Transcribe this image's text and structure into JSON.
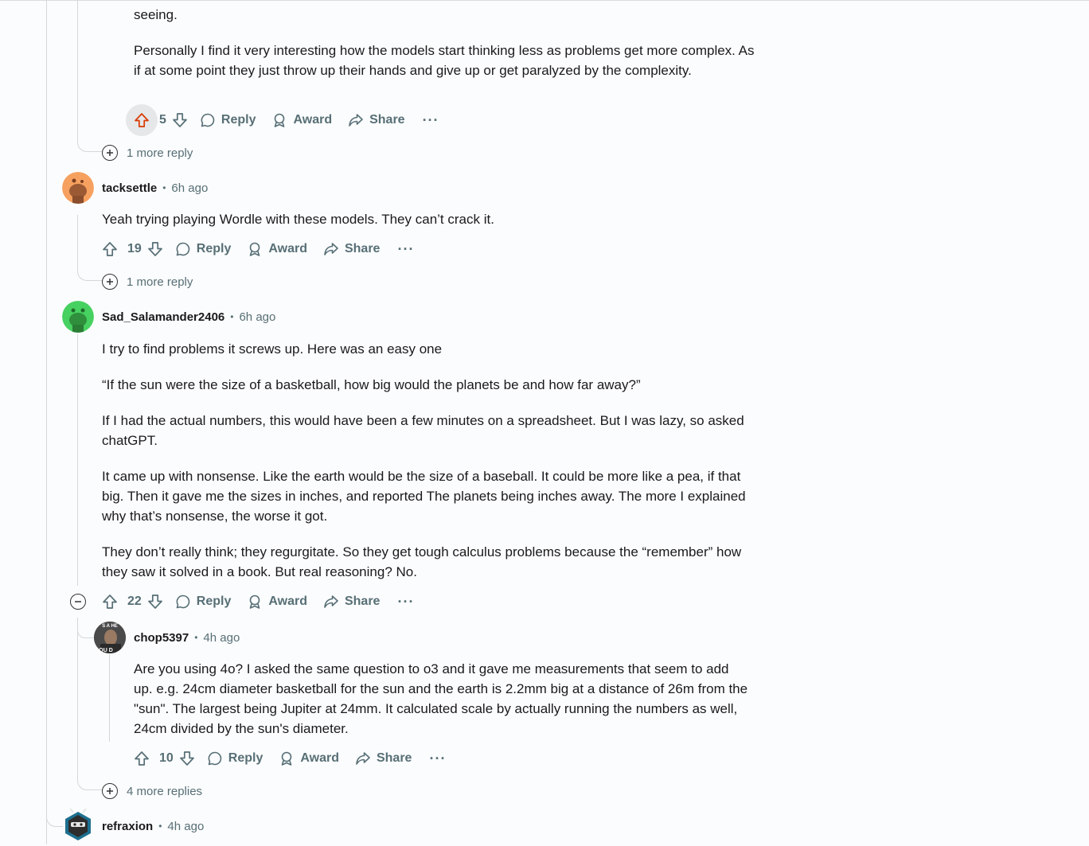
{
  "comment1": {
    "partial_text": "seeing.",
    "paragraph": "Personally I find it very interesting how the models start thinking less as problems get more complex. As if at some point they just throw up their hands and give up or get paralyzed by the complexity.",
    "score": "5",
    "more_replies": "1 more reply"
  },
  "comment2": {
    "author": "tacksettle",
    "time": "6h ago",
    "paragraph": "Yeah trying playing Wordle with these models. They can’t crack it.",
    "score": "19",
    "more_replies": "1 more reply"
  },
  "comment3": {
    "author": "Sad_Salamander2406",
    "time": "6h ago",
    "paragraphs": [
      "I try to find problems it screws up. Here was an easy one",
      "“If the sun were the size of a basketball, how big would the planets be and how far away?”",
      "If I had the actual numbers, this would have been a few minutes on a spreadsheet. But I was lazy, so asked chatGPT.",
      "It came up with nonsense. Like the earth would be the size of a baseball. It could be more like a pea, if that big. Then it gave me the sizes in inches, and reported The planets being inches away. The more I explained why that’s nonsense, the worse it got.",
      "They don’t really think; they regurgitate. So they get tough calculus problems because the “remember” how they saw it solved in a book. But real reasoning? No."
    ],
    "score": "22"
  },
  "comment4": {
    "author": "chop5397",
    "time": "4h ago",
    "avatar_text_top": "S A HE",
    "avatar_text_bottom": "OU D",
    "paragraph": "Are you using 4o? I asked the same question to o3 and it gave me measurements that seem to add up. e.g. 24cm diameter basketball for the sun and the earth is 2.2mm big at a distance of 26m from the \"sun\". The largest being Jupiter at 24mm. It calculated scale by actually running the numbers as well, 24cm divided by the sun's diameter.",
    "score": "10"
  },
  "thread_more_replies": "4 more replies",
  "comment5": {
    "author": "refraxion",
    "time": "4h ago"
  },
  "actions": {
    "reply": "Reply",
    "award": "Award",
    "share": "Share",
    "more": "···"
  },
  "colors": {
    "upvote_active": "#d93a00",
    "meta": "#576f76",
    "avatar_orange": "#f6a15f",
    "avatar_green": "#46d160"
  }
}
